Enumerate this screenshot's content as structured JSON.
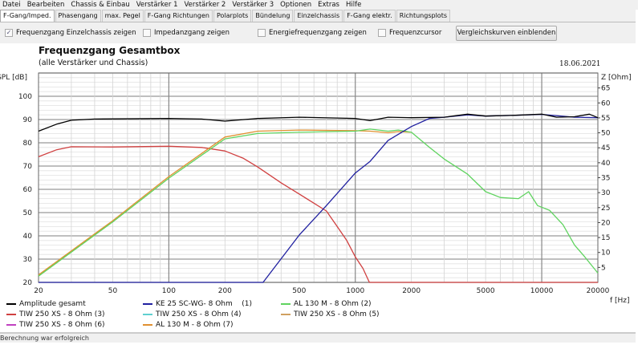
{
  "menu": [
    "Datei",
    "Bearbeiten",
    "Chassis & Einbau",
    "Verstärker 1",
    "Verstärker 2",
    "Verstärker 3",
    "Optionen",
    "Extras",
    "Hilfe"
  ],
  "tabs": [
    "F-Gang/Imped.",
    "Phasengang",
    "max. Pegel",
    "F-Gang Richtungen",
    "Polarplots",
    "Bündelung",
    "Einzelchassis",
    "F-Gang elektr.",
    "Richtungsplots"
  ],
  "toolbar": {
    "checkboxes": [
      {
        "label": "Frequenzgang Einzelchassis zeigen",
        "checked": true
      },
      {
        "label": "Impedanzgang zeigen",
        "checked": false
      },
      {
        "label": "Energiefrequenzgang zeigen",
        "checked": false
      },
      {
        "label": "Frequenzcursor",
        "checked": false
      }
    ],
    "compare_button": "Vergleichskurven einblenden"
  },
  "status": "Berechnung war erfolgreich",
  "chart_data": {
    "type": "line",
    "title": "Frequenzgang Gesamtbox",
    "subtitle": "(alle Verstärker und Chassis)",
    "date": "18.06.2021",
    "ylabel": "SPL [dB]",
    "y2label": "Z [Ohm]",
    "xlabel": "f [Hz]",
    "xscale": "log",
    "xlim": [
      20,
      20000
    ],
    "ylim": [
      20,
      110
    ],
    "y2lim": [
      0,
      70
    ],
    "xticks": [
      "20",
      "50",
      "100",
      "200",
      "500",
      "1000",
      "2000",
      "5000",
      "10000",
      "20000"
    ],
    "yticks": [
      "20",
      "30",
      "40",
      "50",
      "60",
      "70",
      "80",
      "90",
      "100"
    ],
    "y2ticks": [
      "5",
      "10",
      "15",
      "20",
      "25",
      "30",
      "35",
      "40",
      "45",
      "50",
      "55",
      "60",
      "65"
    ],
    "grid": true,
    "series": [
      {
        "name": "Amplitude gesamt",
        "color": "#000000",
        "points": [
          [
            20,
            85
          ],
          [
            25,
            88
          ],
          [
            30,
            89.7
          ],
          [
            40,
            90.2
          ],
          [
            100,
            90.5
          ],
          [
            150,
            90.2
          ],
          [
            200,
            89.3
          ],
          [
            300,
            90.5
          ],
          [
            500,
            91
          ],
          [
            1000,
            90.5
          ],
          [
            1200,
            89.5
          ],
          [
            1500,
            91
          ],
          [
            2000,
            90.8
          ],
          [
            3000,
            91
          ],
          [
            4000,
            92.3
          ],
          [
            5000,
            91.5
          ],
          [
            7000,
            91.8
          ],
          [
            10000,
            92.3
          ],
          [
            12000,
            91
          ],
          [
            15000,
            91.2
          ],
          [
            18000,
            92.3
          ],
          [
            20000,
            90.8
          ]
        ]
      },
      {
        "name": "KE 25 SC-WG- 8 Ohm    (1)",
        "color": "#2020a0",
        "points": [
          [
            20,
            20
          ],
          [
            320,
            20
          ],
          [
            500,
            40.3
          ],
          [
            700,
            53
          ],
          [
            1000,
            67
          ],
          [
            1200,
            72
          ],
          [
            1500,
            81
          ],
          [
            2000,
            87
          ],
          [
            2500,
            90.5
          ],
          [
            3000,
            91
          ],
          [
            4000,
            92
          ],
          [
            5000,
            91.5
          ],
          [
            7000,
            91.8
          ],
          [
            10000,
            92.2
          ],
          [
            15000,
            91
          ],
          [
            20000,
            90.8
          ]
        ]
      },
      {
        "name": "AL 130 M - 8 Ohm (2)",
        "color": "#5fd35f",
        "points": [
          [
            20,
            22.7
          ],
          [
            50,
            46
          ],
          [
            100,
            64.8
          ],
          [
            200,
            81.7
          ],
          [
            300,
            84
          ],
          [
            500,
            84.5
          ],
          [
            1000,
            85
          ],
          [
            1200,
            85.9
          ],
          [
            1500,
            85
          ],
          [
            1700,
            85.5
          ],
          [
            2000,
            84.5
          ],
          [
            2500,
            78
          ],
          [
            3000,
            73
          ],
          [
            4000,
            66.5
          ],
          [
            5000,
            59
          ],
          [
            6000,
            56.5
          ],
          [
            7500,
            56
          ],
          [
            8500,
            59
          ],
          [
            9500,
            53
          ],
          [
            11000,
            51
          ],
          [
            13000,
            44.8
          ],
          [
            15000,
            36
          ],
          [
            17000,
            31
          ],
          [
            20000,
            24
          ]
        ]
      },
      {
        "name": "TIW 250 XS - 8 Ohm (3)",
        "color": "#d04040",
        "points": [
          [
            20,
            74
          ],
          [
            25,
            77
          ],
          [
            30,
            78.3
          ],
          [
            50,
            78.2
          ],
          [
            100,
            78.5
          ],
          [
            150,
            78
          ],
          [
            200,
            76.5
          ],
          [
            250,
            73.4
          ],
          [
            300,
            69.6
          ],
          [
            400,
            62.8
          ],
          [
            500,
            58
          ],
          [
            700,
            50.7
          ],
          [
            800,
            44
          ],
          [
            900,
            38
          ],
          [
            1000,
            31
          ],
          [
            1100,
            26
          ],
          [
            1190,
            20
          ],
          [
            20000,
            20
          ]
        ]
      },
      {
        "name": "TIW 250 XS - 8 Ohm (4)",
        "color": "#5fd0d0",
        "points": []
      },
      {
        "name": "TIW 250 XS - 8 Ohm (5)",
        "color": "#d0a060",
        "points": []
      },
      {
        "name": "TIW 250 XS - 8 Ohm (6)",
        "color": "#c040c0",
        "points": []
      },
      {
        "name": "AL 130 M - 8 Ohm (7)",
        "color": "#e09030",
        "points": [
          [
            20,
            23.2
          ],
          [
            50,
            46.5
          ],
          [
            100,
            65.5
          ],
          [
            200,
            82.5
          ],
          [
            300,
            85
          ],
          [
            500,
            85.5
          ],
          [
            1000,
            85.2
          ],
          [
            1200,
            85
          ],
          [
            1500,
            84.3
          ],
          [
            1700,
            84.8
          ],
          [
            2000,
            84.5
          ]
        ]
      }
    ]
  }
}
